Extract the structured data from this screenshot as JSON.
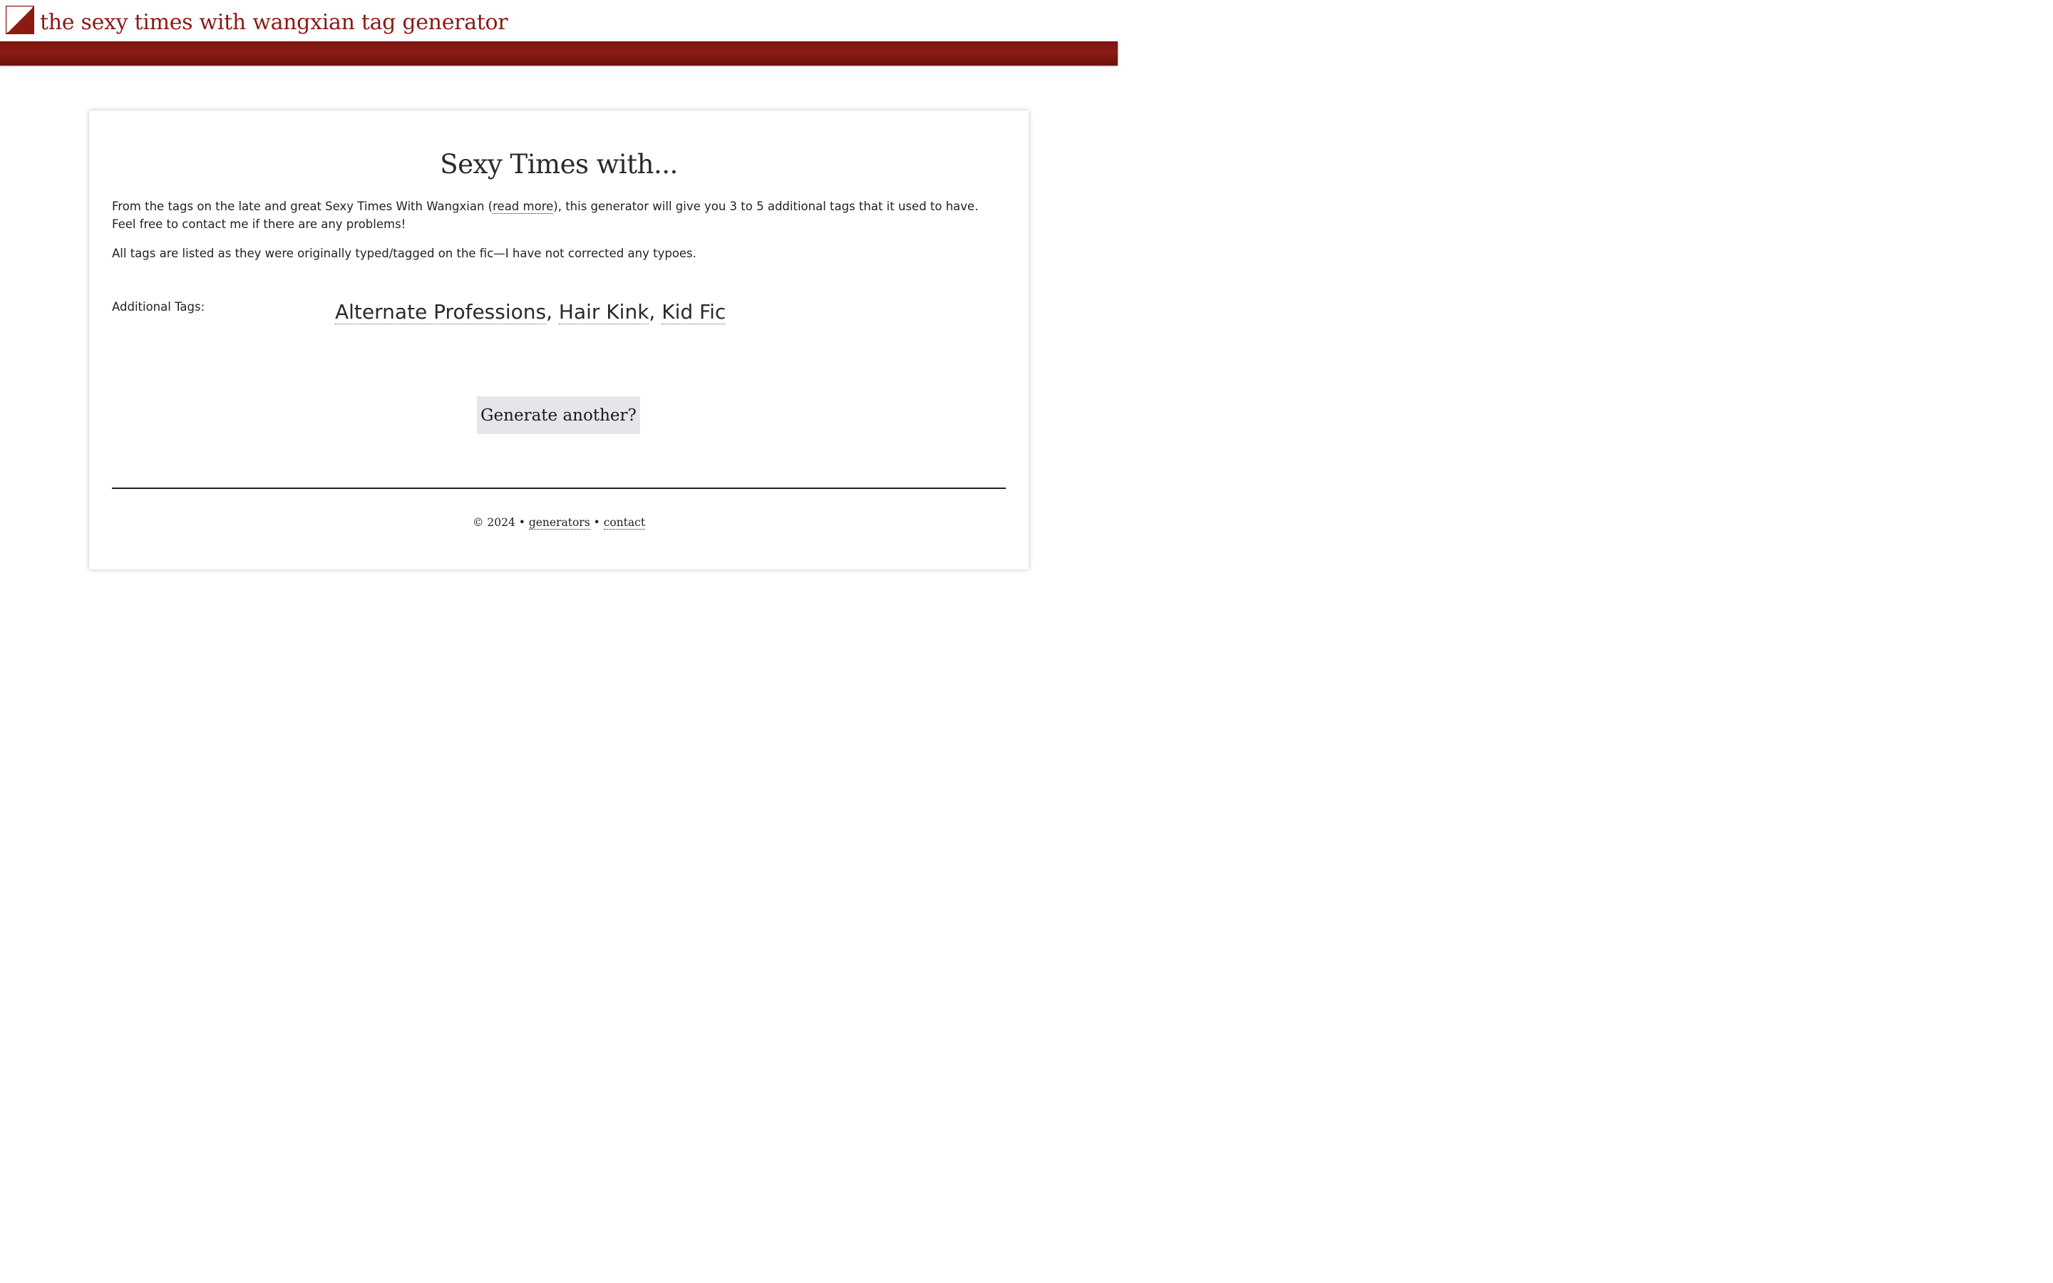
{
  "header": {
    "title": "the sexy times with wangxian tag generator",
    "brand_color": "#8b1a12",
    "logo_icon": "diagonal-split-square-icon"
  },
  "main": {
    "heading": "Sexy Times with...",
    "intro_before_link": "From the tags on the late and great Sexy Times With Wangxian (",
    "intro_link": "read more",
    "intro_after_link": "), this generator will give you 3 to 5 additional tags that it used to have. Feel free to contact me if there are any problems!",
    "note": "All tags are listed as they were originally typed/tagged on the fic—I have not corrected any typoes.",
    "tags_label": "Additional Tags:",
    "tags": [
      "Alternate Professions",
      "Hair Kink",
      "Kid Fic"
    ],
    "tag_separator": ", ",
    "generate_button": "Generate another?"
  },
  "footer": {
    "copyright": "© 2024 •",
    "link_generators": "generators",
    "separator": "•",
    "link_contact": "contact"
  }
}
